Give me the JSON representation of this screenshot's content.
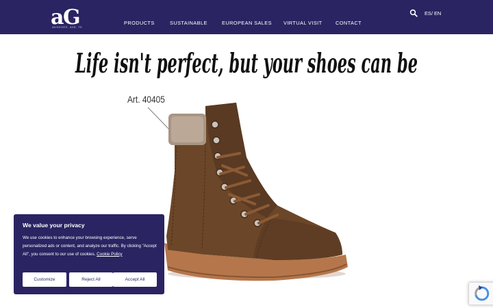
{
  "header": {
    "logo_caption": "AKSHOES, AVE, TE",
    "nav": [
      {
        "label": "PRODUCTS"
      },
      {
        "label": "SUSTAINABLE"
      },
      {
        "label": "EUROPEAN SALES"
      },
      {
        "label": "VIRTUAL VISIT"
      },
      {
        "label": "CONTACT"
      }
    ],
    "lang_es": "ES",
    "lang_sep": "/",
    "lang_en": "EN",
    "search_icon": "search-icon"
  },
  "hero": {
    "slogan": "Life isn't perfect, but your shoes can be",
    "article": "Art. 40405"
  },
  "cookie_banner": {
    "title": "We value your privacy",
    "text": "We use cookies to enhance your browsing experience, serve personalized ads or content, and analyze our traffic. By clicking \"Accept All\", you consent to our use of cookies.",
    "link": "Cookie Policy",
    "buttons": {
      "customize": "Customize",
      "reject": "Reject All",
      "accept": "Accept All"
    }
  },
  "colors": {
    "brand": "#2a2462",
    "boot_leather": "#6b4628",
    "sole": "#b5764b"
  }
}
